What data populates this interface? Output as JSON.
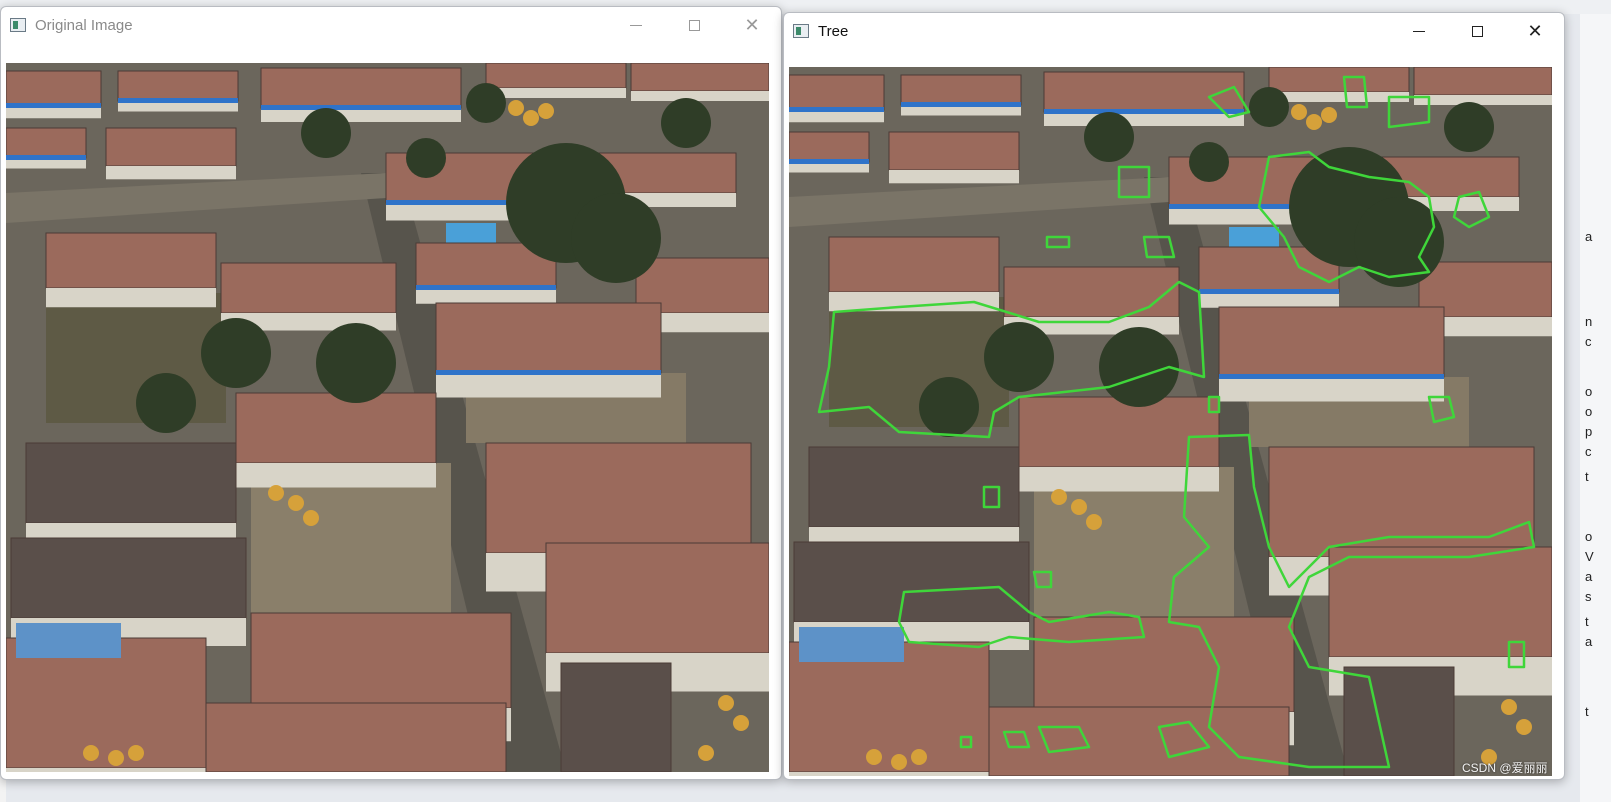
{
  "windows": {
    "original": {
      "title": "Original Image"
    },
    "tree": {
      "title": "Tree"
    }
  },
  "controls": {
    "minimize": "minimize",
    "maximize": "maximize",
    "close": "close"
  },
  "watermark": "CSDN @爱丽丽",
  "background_strip_chars": [
    "a",
    "n",
    "c",
    "o",
    "o",
    "p",
    "c",
    "t",
    "o",
    "V",
    "a",
    "s",
    "t",
    "a",
    "t"
  ],
  "overlay": {
    "color": "#3fd63a"
  },
  "palette": {
    "ground": "#6b665c",
    "roof_red": "#9b6a5c",
    "roof_dark": "#5a4f4a",
    "wall": "#d8d4c8",
    "tree": "#2f3d27",
    "blue_trim": "#2f73c9",
    "corn": "#d6a13a"
  }
}
